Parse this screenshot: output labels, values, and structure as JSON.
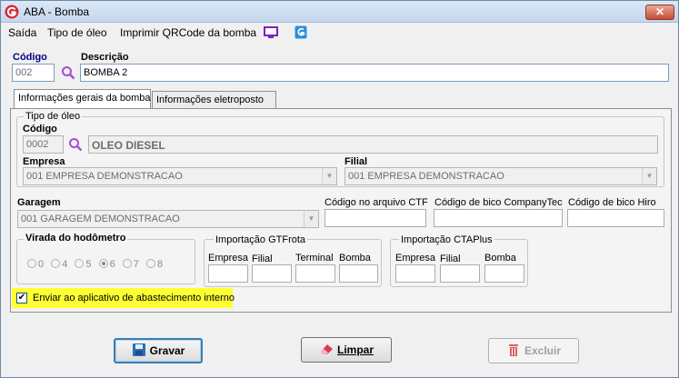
{
  "window": {
    "title": "ABA - Bomba",
    "close_glyph": "✕"
  },
  "menu": {
    "items": [
      "Saída",
      "Tipo de óleo",
      "Imprimir QRCode da bomba"
    ]
  },
  "header": {
    "codigo_label": "Código",
    "codigo_value": "002",
    "descricao_label": "Descrição",
    "descricao_value": "BOMBA 2"
  },
  "tabs": [
    "Informações gerais da bomba",
    "Informações eletroposto"
  ],
  "tipo_oleo": {
    "group_label": "Tipo de óleo",
    "codigo_label": "Código",
    "codigo_value": "0002",
    "descricao_value": "OLEO DIESEL",
    "empresa_label": "Empresa",
    "empresa_value": "001 EMPRESA DEMONSTRACAO",
    "filial_label": "Filial",
    "filial_value": "001 EMPRESA DEMONSTRACAO"
  },
  "garagem": {
    "label": "Garagem",
    "value": "001 GARAGEM DEMONSTRACAO",
    "ctf_label": "Código no arquivo CTF",
    "ctf_value": "",
    "companytec_label": "Código de bico CompanyTec",
    "companytec_value": "",
    "hiro_label": "Código de bico Hiro",
    "hiro_value": ""
  },
  "hodometro": {
    "label": "Virada do hodômetro",
    "options": [
      "0",
      "4",
      "5",
      "6",
      "7",
      "8"
    ],
    "selected": "6"
  },
  "gtfrota": {
    "label": "Importação GTFrota",
    "fields": [
      "Empresa",
      "Filial",
      "Terminal",
      "Bomba"
    ]
  },
  "ctaplus": {
    "label": "Importação CTAPlus",
    "fields": [
      "Empresa",
      "Filial",
      "Bomba"
    ]
  },
  "enviar": {
    "label": "Enviar ao aplicativo de abastecimento interno",
    "checked": true,
    "check_glyph": "✔"
  },
  "buttons": {
    "gravar": "Gravar",
    "limpar": "Limpar",
    "excluir": "Excluir"
  },
  "colors": {
    "highlight": "#ffff33",
    "accent": "#3c7fb1",
    "delete_icon": "#e06060"
  }
}
